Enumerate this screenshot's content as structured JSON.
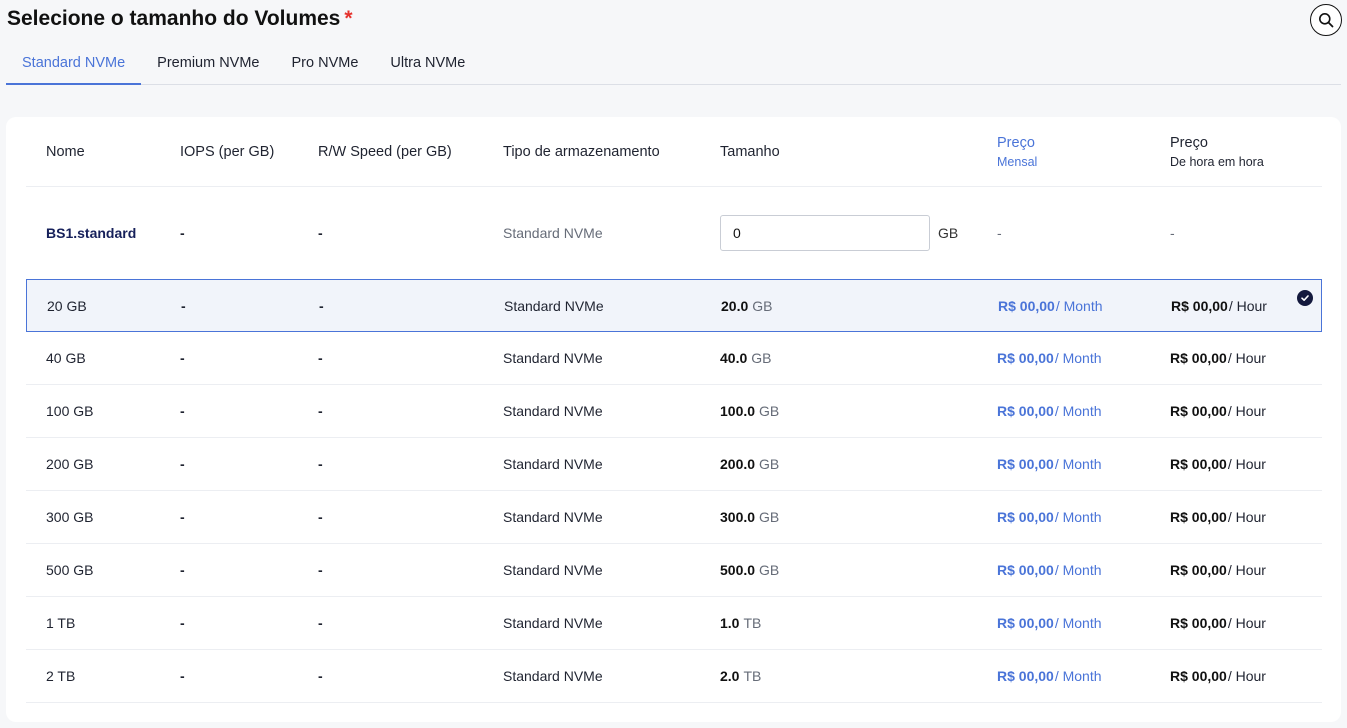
{
  "title": "Selecione o tamanho do Volumes",
  "required_mark": "*",
  "tabs": [
    "Standard NVMe",
    "Premium NVMe",
    "Pro NVMe",
    "Ultra NVMe"
  ],
  "active_tab": 0,
  "columns": {
    "name": "Nome",
    "iops": "IOPS (per GB)",
    "rw": "R/W Speed (per GB)",
    "type": "Tipo de armazenamento",
    "size": "Tamanho",
    "price_monthly": "Preço",
    "price_monthly_sub": "Mensal",
    "price_hourly": "Preço",
    "price_hourly_sub": "De hora em hora"
  },
  "custom_row": {
    "name": "BS1.standard",
    "iops": "-",
    "rw": "-",
    "type": "Standard NVMe",
    "input_value": "0",
    "input_unit": "GB",
    "price_monthly": "-",
    "price_hourly": "-"
  },
  "plans": [
    {
      "name": "20 GB",
      "iops": "-",
      "rw": "-",
      "type": "Standard NVMe",
      "size": "20.0",
      "unit": "GB",
      "monthly": "R$ 00,00",
      "monthly_unit": "/ Month",
      "hourly": "R$ 00,00",
      "hourly_unit": "/ Hour",
      "selected": true
    },
    {
      "name": "40 GB",
      "iops": "-",
      "rw": "-",
      "type": "Standard NVMe",
      "size": "40.0",
      "unit": "GB",
      "monthly": "R$ 00,00",
      "monthly_unit": "/ Month",
      "hourly": "R$ 00,00",
      "hourly_unit": "/ Hour",
      "selected": false
    },
    {
      "name": "100 GB",
      "iops": "-",
      "rw": "-",
      "type": "Standard NVMe",
      "size": "100.0",
      "unit": "GB",
      "monthly": "R$ 00,00",
      "monthly_unit": "/ Month",
      "hourly": "R$ 00,00",
      "hourly_unit": "/ Hour",
      "selected": false
    },
    {
      "name": "200 GB",
      "iops": "-",
      "rw": "-",
      "type": "Standard NVMe",
      "size": "200.0",
      "unit": "GB",
      "monthly": "R$ 00,00",
      "monthly_unit": "/ Month",
      "hourly": "R$ 00,00",
      "hourly_unit": "/ Hour",
      "selected": false
    },
    {
      "name": "300 GB",
      "iops": "-",
      "rw": "-",
      "type": "Standard NVMe",
      "size": "300.0",
      "unit": "GB",
      "monthly": "R$ 00,00",
      "monthly_unit": "/ Month",
      "hourly": "R$ 00,00",
      "hourly_unit": "/ Hour",
      "selected": false
    },
    {
      "name": "500 GB",
      "iops": "-",
      "rw": "-",
      "type": "Standard NVMe",
      "size": "500.0",
      "unit": "GB",
      "monthly": "R$ 00,00",
      "monthly_unit": "/ Month",
      "hourly": "R$ 00,00",
      "hourly_unit": "/ Hour",
      "selected": false
    },
    {
      "name": "1 TB",
      "iops": "-",
      "rw": "-",
      "type": "Standard NVMe",
      "size": "1.0",
      "unit": "TB",
      "monthly": "R$ 00,00",
      "monthly_unit": "/ Month",
      "hourly": "R$ 00,00",
      "hourly_unit": "/ Hour",
      "selected": false
    },
    {
      "name": "2 TB",
      "iops": "-",
      "rw": "-",
      "type": "Standard NVMe",
      "size": "2.0",
      "unit": "TB",
      "monthly": "R$ 00,00",
      "monthly_unit": "/ Month",
      "hourly": "R$ 00,00",
      "hourly_unit": "/ Hour",
      "selected": false
    }
  ],
  "icons": {
    "search": "search-icon",
    "selected": "check-circle-icon"
  },
  "colors": {
    "accent": "#4a74d8",
    "required": "#e5322d",
    "selected_bg": "#f1f4fa",
    "check": "#14193d"
  }
}
